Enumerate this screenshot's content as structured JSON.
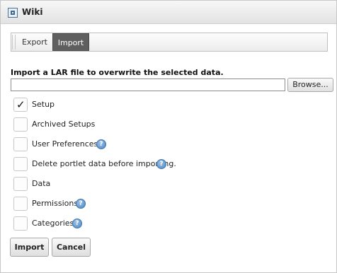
{
  "portlet": {
    "title": "Wiki",
    "icon": "portlet-icon"
  },
  "tabs": [
    {
      "label": "Export",
      "selected": false
    },
    {
      "label": "Import",
      "selected": true
    }
  ],
  "form": {
    "instructions": "Import a LAR file to overwrite the selected data.",
    "file_value": "",
    "browse_label": "Browse..."
  },
  "options": [
    {
      "label": "Setup",
      "checked": true,
      "help": false
    },
    {
      "label": "Archived Setups",
      "checked": false,
      "help": false
    },
    {
      "label": "User Preferences",
      "checked": false,
      "help": true
    },
    {
      "label": "Delete portlet data before importing.",
      "checked": false,
      "help": true
    },
    {
      "label": "Data",
      "checked": false,
      "help": false
    },
    {
      "label": "Permissions",
      "checked": false,
      "help": true
    },
    {
      "label": "Categories",
      "checked": false,
      "help": true
    }
  ],
  "actions": {
    "import_label": "Import",
    "cancel_label": "Cancel"
  },
  "glyphs": {
    "check": "✓",
    "help": "?"
  },
  "colors": {
    "selected_tab": "#5f5f5f",
    "help_icon": "#4a86c4"
  }
}
